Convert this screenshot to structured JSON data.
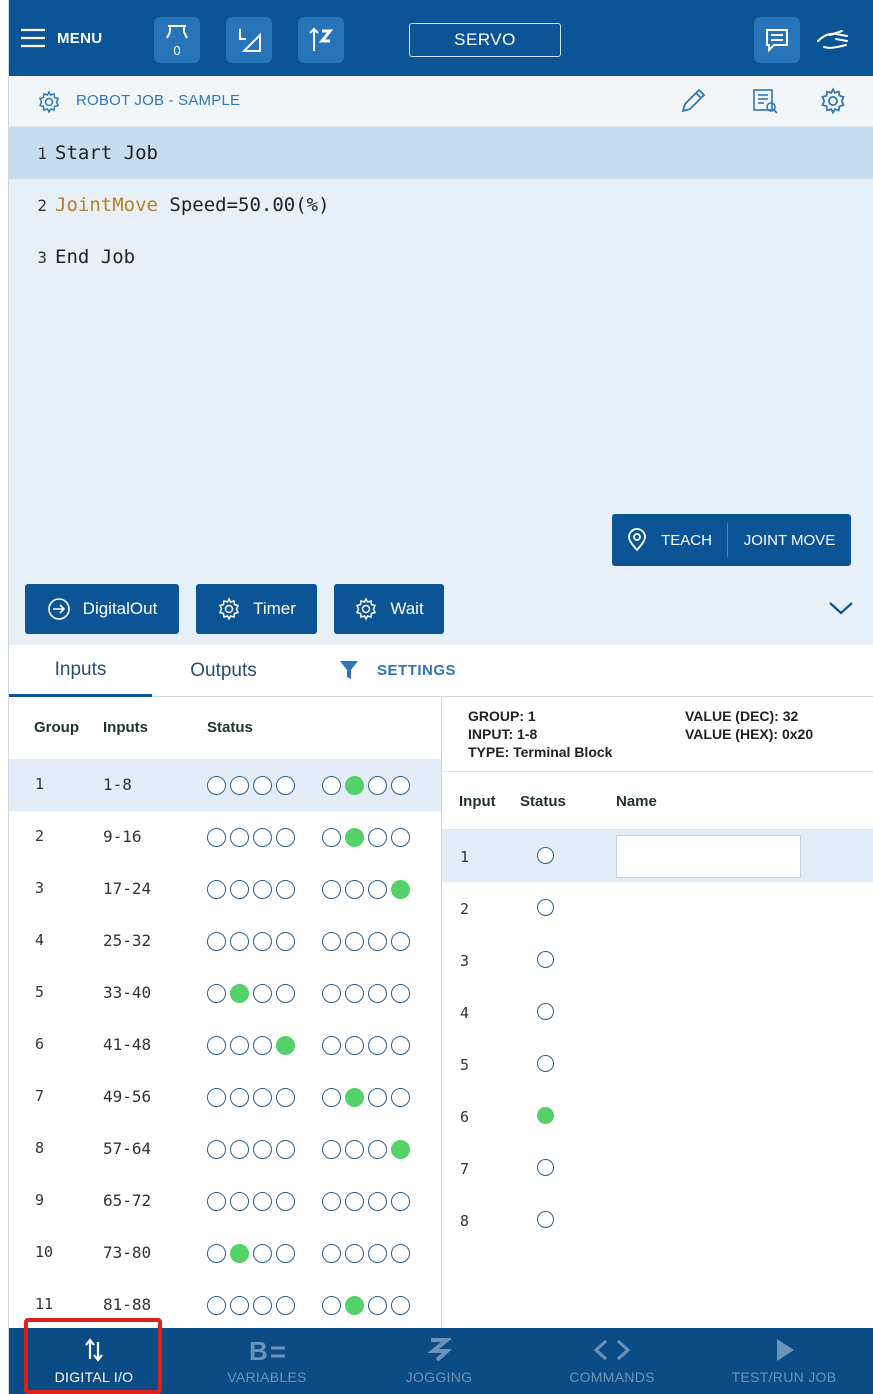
{
  "topbar": {
    "menu_label": "MENU",
    "tool_badge": "0",
    "servo_label": "SERVO"
  },
  "job": {
    "title": "ROBOT JOB - SAMPLE"
  },
  "program": {
    "lines": [
      {
        "num": "1",
        "keyword": "",
        "text": "Start Job"
      },
      {
        "num": "2",
        "keyword": "JointMove",
        "text": " Speed=50.00(%)"
      },
      {
        "num": "3",
        "keyword": "",
        "text": "End Job"
      }
    ]
  },
  "teach": {
    "teach_label": "TEACH",
    "move_label": "JOINT MOVE"
  },
  "commands": {
    "digitalout": "DigitalOut",
    "timer": "Timer",
    "wait": "Wait"
  },
  "io": {
    "tab_inputs": "Inputs",
    "tab_outputs": "Outputs",
    "settings": "SETTINGS",
    "headers": {
      "group": "Group",
      "inputs": "Inputs",
      "status": "Status"
    },
    "rows": [
      {
        "group": "1",
        "range": "1-8",
        "bits": [
          0,
          0,
          0,
          0,
          0,
          1,
          0,
          0
        ]
      },
      {
        "group": "2",
        "range": "9-16",
        "bits": [
          0,
          0,
          0,
          0,
          0,
          1,
          0,
          0
        ]
      },
      {
        "group": "3",
        "range": "17-24",
        "bits": [
          0,
          0,
          0,
          0,
          0,
          0,
          0,
          1
        ]
      },
      {
        "group": "4",
        "range": "25-32",
        "bits": [
          0,
          0,
          0,
          0,
          0,
          0,
          0,
          0
        ]
      },
      {
        "group": "5",
        "range": "33-40",
        "bits": [
          0,
          1,
          0,
          0,
          0,
          0,
          0,
          0
        ]
      },
      {
        "group": "6",
        "range": "41-48",
        "bits": [
          0,
          0,
          0,
          1,
          0,
          0,
          0,
          0
        ]
      },
      {
        "group": "7",
        "range": "49-56",
        "bits": [
          0,
          0,
          0,
          0,
          0,
          1,
          0,
          0
        ]
      },
      {
        "group": "8",
        "range": "57-64",
        "bits": [
          0,
          0,
          0,
          0,
          0,
          0,
          0,
          1
        ]
      },
      {
        "group": "9",
        "range": "65-72",
        "bits": [
          0,
          0,
          0,
          0,
          0,
          0,
          0,
          0
        ]
      },
      {
        "group": "10",
        "range": "73-80",
        "bits": [
          0,
          1,
          0,
          0,
          0,
          0,
          0,
          0
        ]
      },
      {
        "group": "11",
        "range": "81-88",
        "bits": [
          0,
          0,
          0,
          0,
          0,
          1,
          0,
          0
        ]
      }
    ],
    "detail": {
      "group": "GROUP: 1",
      "input": "INPUT: 1-8",
      "type": "TYPE: Terminal Block",
      "value_dec": "VALUE (DEC): 32",
      "value_hex": "VALUE (HEX): 0x20",
      "headers": {
        "input": "Input",
        "status": "Status",
        "name": "Name"
      },
      "items": [
        {
          "num": "1",
          "on": false
        },
        {
          "num": "2",
          "on": false
        },
        {
          "num": "3",
          "on": false
        },
        {
          "num": "4",
          "on": false
        },
        {
          "num": "5",
          "on": false
        },
        {
          "num": "6",
          "on": true
        },
        {
          "num": "7",
          "on": false
        },
        {
          "num": "8",
          "on": false
        }
      ],
      "name_value": ""
    }
  },
  "nav": {
    "items": [
      {
        "label": "DIGITAL I/O",
        "icon": "digital-io-icon"
      },
      {
        "label": "VARIABLES",
        "icon": "variables-icon"
      },
      {
        "label": "JOGGING",
        "icon": "jogging-icon"
      },
      {
        "label": "COMMANDS",
        "icon": "commands-icon"
      },
      {
        "label": "TEST/RUN JOB",
        "icon": "play-icon"
      }
    ]
  },
  "colors": {
    "primary": "#0b5596",
    "on": "#55d16a",
    "highlight": "#e0201b"
  }
}
